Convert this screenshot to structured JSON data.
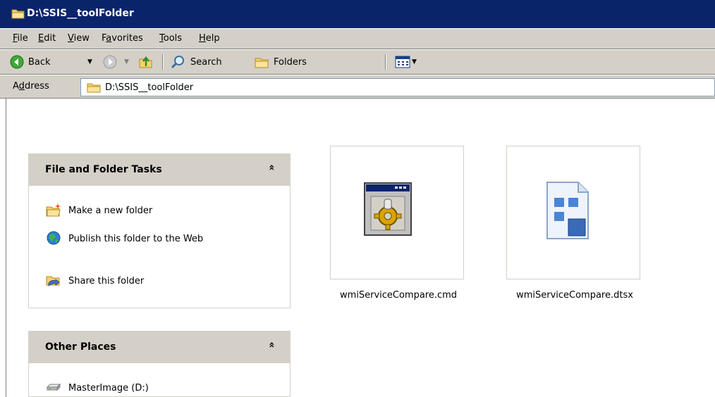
{
  "window": {
    "title": "D:\\SSIS__toolFolder"
  },
  "menu": [
    {
      "label": "File",
      "key": "F",
      "rest": "ile"
    },
    {
      "label": "Edit",
      "key": "E",
      "rest": "dit"
    },
    {
      "label": "View",
      "key": "V",
      "rest": "iew"
    },
    {
      "label": "Favorites",
      "pre": "F",
      "key": "a",
      "rest": "vorites"
    },
    {
      "label": "Tools",
      "key": "T",
      "rest": "ools"
    },
    {
      "label": "Help",
      "key": "H",
      "rest": "elp"
    }
  ],
  "toolbar": {
    "back": "Back",
    "search": "Search",
    "folders": "Folders"
  },
  "address": {
    "label_pre": "A",
    "label_key": "d",
    "label_rest": "dress",
    "value": "D:\\SSIS__toolFolder"
  },
  "file_folder_tasks": {
    "title": "File and Folder Tasks",
    "chevron": "»",
    "items": [
      {
        "label": "Make a new folder",
        "icon": "new-folder-icon"
      },
      {
        "label": "Publish this folder to the Web",
        "icon": "publish-web-icon"
      },
      {
        "label": "Share this folder",
        "icon": "share-folder-icon"
      }
    ]
  },
  "other_places": {
    "title": "Other Places",
    "chevron": "»",
    "items": [
      {
        "label": "MasterImage (D:)",
        "icon": "drive-icon"
      }
    ]
  },
  "files": [
    {
      "name": "wmiServiceCompare.cmd",
      "icon": "cmd-file-icon"
    },
    {
      "name": "wmiServiceCompare.dtsx",
      "icon": "dtsx-file-icon"
    }
  ],
  "colors": {
    "titlebar": "#0a246a",
    "chrome": "#d4d0c8"
  }
}
